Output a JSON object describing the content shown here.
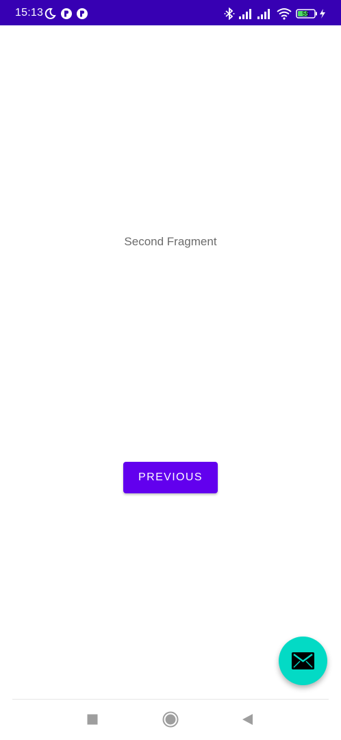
{
  "status_bar": {
    "time": "15:13",
    "background_color": "#3700b3",
    "left_icons": [
      "moon-icon",
      "notification-app-icon",
      "notification-app-icon"
    ],
    "right_icons": [
      "bluetooth-icon",
      "signal-icon",
      "signal-icon",
      "wifi-icon",
      "battery-icon",
      "charging-icon"
    ],
    "battery_level": "55"
  },
  "content": {
    "fragment_label": "Second Fragment",
    "previous_button_label": "PREVIOUS",
    "primary_color": "#6200ee"
  },
  "fab": {
    "icon": "mail-icon",
    "color": "#03dac5"
  },
  "navigation_bar": {
    "buttons": [
      "recents-square-icon",
      "home-circle-icon",
      "back-triangle-icon"
    ]
  }
}
